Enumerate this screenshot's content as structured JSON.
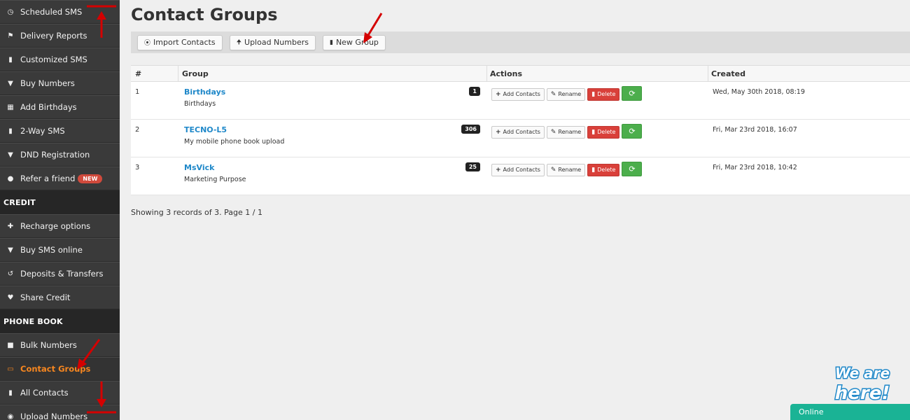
{
  "sidebar": {
    "items_top": [
      {
        "label": "Scheduled SMS",
        "icon": "clock-icon"
      },
      {
        "label": "Delivery Reports",
        "icon": "flag-icon"
      },
      {
        "label": "Customized SMS",
        "icon": "comment-icon"
      },
      {
        "label": "Buy Numbers",
        "icon": "cart-icon"
      },
      {
        "label": "Add Birthdays",
        "icon": "grid-icon"
      },
      {
        "label": "2-Way SMS",
        "icon": "comment-icon"
      },
      {
        "label": "DND Registration",
        "icon": "filter-icon"
      },
      {
        "label": "Refer a friend",
        "icon": "user-icon",
        "badge": "NEW"
      }
    ],
    "credit_heading": "CREDIT",
    "credit_items": [
      {
        "label": "Recharge options",
        "icon": "plus-icon"
      },
      {
        "label": "Buy SMS online",
        "icon": "cart-icon"
      },
      {
        "label": "Deposits & Transfers",
        "icon": "transfer-icon"
      },
      {
        "label": "Share Credit",
        "icon": "heart-icon"
      }
    ],
    "phonebook_heading": "PHONE BOOK",
    "phonebook_items": [
      {
        "label": "Bulk Numbers",
        "icon": "folder-icon"
      },
      {
        "label": "Contact Groups",
        "icon": "folder-open-icon",
        "active": true
      },
      {
        "label": "All Contacts",
        "icon": "book-icon"
      },
      {
        "label": "Upload Numbers",
        "icon": "upload-icon"
      }
    ]
  },
  "main": {
    "title": "Contact Groups",
    "toolbar": {
      "import_label": "Import Contacts",
      "upload_label": "Upload Numbers",
      "new_group_label": "New Group"
    },
    "table": {
      "headers": {
        "num": "#",
        "group": "Group",
        "actions": "Actions",
        "created": "Created"
      },
      "action_labels": {
        "add": "Add Contacts",
        "rename": "Rename",
        "delete": "Delete"
      },
      "rows": [
        {
          "num": "1",
          "name": "Birthdays",
          "desc": "Birthdays",
          "count": "1",
          "created": "Wed, May 30th 2018, 08:19"
        },
        {
          "num": "2",
          "name": "TECNO-L5",
          "desc": "My mobile phone book upload",
          "count": "306",
          "created": "Fri, Mar 23rd 2018, 16:07"
        },
        {
          "num": "3",
          "name": "MsVick",
          "desc": "Marketing Purpose",
          "count": "25",
          "created": "Fri, Mar 23rd 2018, 10:42"
        }
      ]
    },
    "footer_info": "Showing 3 records of 3. Page 1 / 1"
  },
  "chat": {
    "logo_text_line1": "We are",
    "logo_text_line2": "here!",
    "status": "Online"
  },
  "colors": {
    "sidebar_bg": "#3a3a3a",
    "active_accent": "#f6861f",
    "link": "#1f88c9",
    "delete": "#d9403a",
    "refresh": "#4cae4c",
    "annotation_arrow": "#d40000",
    "chat": "#1ab395"
  }
}
